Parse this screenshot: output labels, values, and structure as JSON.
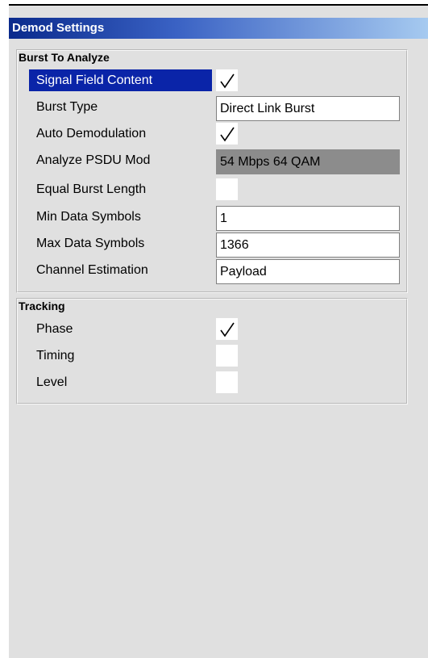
{
  "window": {
    "title": "Demod Settings"
  },
  "burst_group": {
    "title": "Burst To Analyze",
    "rows": [
      {
        "label": "Signal Field Content",
        "type": "checkbox",
        "checked": true,
        "selected": true
      },
      {
        "label": "Burst Type",
        "type": "field",
        "value": "Direct Link Burst"
      },
      {
        "label": "Auto Demodulation",
        "type": "checkbox",
        "checked": true
      },
      {
        "label": "Analyze PSDU Mod",
        "type": "field",
        "value": "54 Mbps 64 QAM",
        "disabled": true
      },
      {
        "label": "Equal Burst Length",
        "type": "checkbox",
        "checked": false
      },
      {
        "label": "Min Data Symbols",
        "type": "field",
        "value": "1"
      },
      {
        "label": "Max Data Symbols",
        "type": "field",
        "value": "1366"
      },
      {
        "label": "Channel Estimation",
        "type": "field",
        "value": "Payload"
      }
    ]
  },
  "tracking_group": {
    "title": "Tracking",
    "rows": [
      {
        "label": "Phase",
        "type": "checkbox",
        "checked": true
      },
      {
        "label": "Timing",
        "type": "checkbox",
        "checked": false
      },
      {
        "label": "Level",
        "type": "checkbox",
        "checked": false
      }
    ]
  },
  "colors": {
    "selection": "#0a24a8",
    "title_gradient_start": "#0a2a8c",
    "title_gradient_end": "#a6caf0",
    "panel_bg": "#e0e0e0",
    "disabled_field": "#8c8c8c"
  }
}
